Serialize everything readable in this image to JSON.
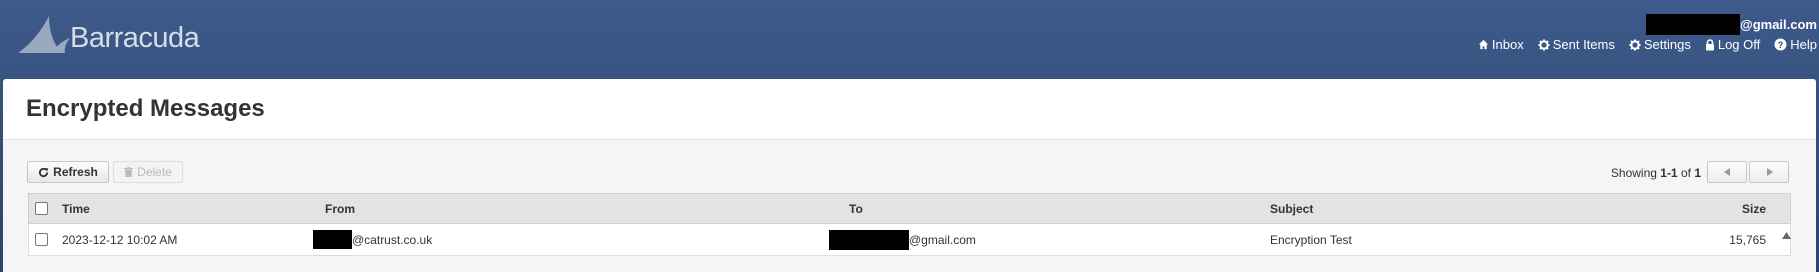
{
  "header": {
    "logo_text": "Barracuda",
    "user_email_suffix": "@gmail.com",
    "nav": [
      {
        "label": "Inbox",
        "icon": "home-icon"
      },
      {
        "label": "Sent Items",
        "icon": "gear-icon"
      },
      {
        "label": "Settings",
        "icon": "gear-icon"
      },
      {
        "label": "Log Off",
        "icon": "lock-icon"
      },
      {
        "label": "Help",
        "icon": "help-icon"
      }
    ]
  },
  "page": {
    "title": "Encrypted Messages"
  },
  "toolbar": {
    "refresh_label": "Refresh",
    "delete_label": "Delete",
    "showing_prefix": "Showing",
    "showing_range": "1-1",
    "showing_of": "of",
    "showing_total": "1"
  },
  "table": {
    "columns": [
      "Time",
      "From",
      "To",
      "Subject",
      "Size"
    ],
    "rows": [
      {
        "time": "2023-12-12 10:02 AM",
        "from_suffix": "@catrust.co.uk",
        "to_suffix": "@gmail.com",
        "subject": "Encryption Test",
        "size": "15,765"
      }
    ]
  },
  "colors": {
    "header_bg": "#3d5a8a",
    "panel_bg": "#f5f5f5",
    "table_header_bg": "#e3e3e3"
  }
}
